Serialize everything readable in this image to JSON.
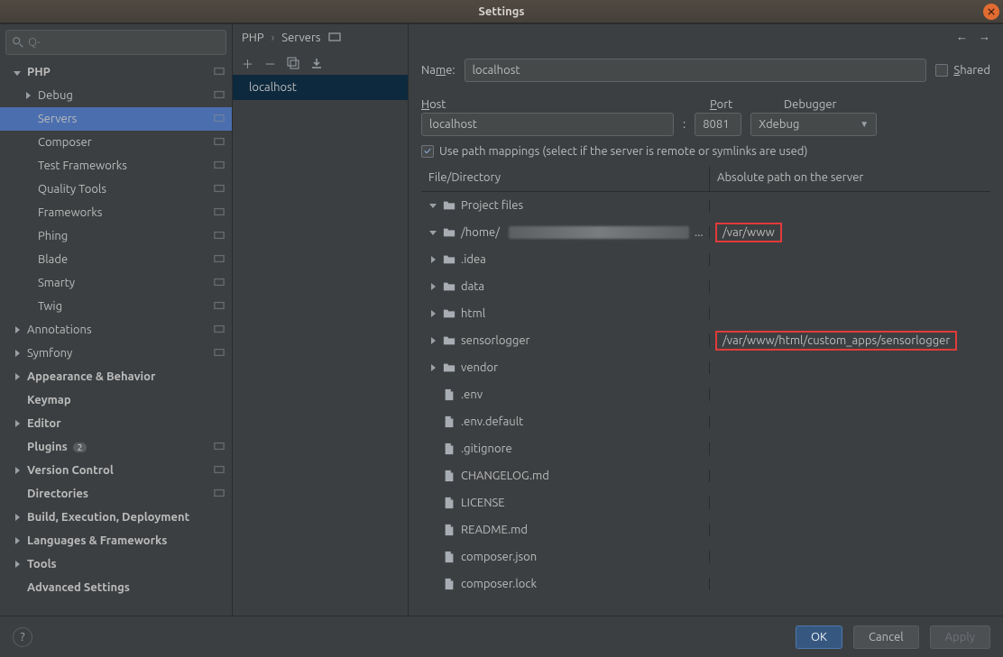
{
  "title": "Settings",
  "search_placeholder": "Q-",
  "nav_tree": [
    {
      "label": "PHP",
      "chev": "exp",
      "bold": true,
      "pin": true
    },
    {
      "label": "Debug",
      "lvl": 1,
      "chev": "col",
      "pin": true
    },
    {
      "label": "Servers",
      "lvl": 1,
      "chev": "none",
      "pin": true,
      "selected": true
    },
    {
      "label": "Composer",
      "lvl": 1,
      "chev": "none",
      "pin": true
    },
    {
      "label": "Test Frameworks",
      "lvl": 1,
      "chev": "none",
      "pin": true
    },
    {
      "label": "Quality Tools",
      "lvl": 1,
      "chev": "none",
      "pin": true
    },
    {
      "label": "Frameworks",
      "lvl": 1,
      "chev": "none",
      "pin": true
    },
    {
      "label": "Phing",
      "lvl": 1,
      "chev": "none",
      "pin": true
    },
    {
      "label": "Blade",
      "lvl": 1,
      "chev": "none",
      "pin": true
    },
    {
      "label": "Smarty",
      "lvl": 1,
      "chev": "none",
      "pin": true
    },
    {
      "label": "Twig",
      "lvl": 1,
      "chev": "none",
      "pin": true
    },
    {
      "label": "Annotations",
      "lvl": 0,
      "chev": "col",
      "pin": true
    },
    {
      "label": "Symfony",
      "lvl": 0,
      "chev": "col",
      "pin": true
    },
    {
      "label": "Appearance & Behavior",
      "chev": "col",
      "bold": true
    },
    {
      "label": "Keymap",
      "chev": "none",
      "bold": true
    },
    {
      "label": "Editor",
      "chev": "col",
      "bold": true
    },
    {
      "label": "Plugins",
      "chev": "none",
      "bold": true,
      "badge": "2",
      "pin": true
    },
    {
      "label": "Version Control",
      "chev": "col",
      "bold": true,
      "pin": true
    },
    {
      "label": "Directories",
      "chev": "none",
      "bold": true,
      "pin": true
    },
    {
      "label": "Build, Execution, Deployment",
      "chev": "col",
      "bold": true
    },
    {
      "label": "Languages & Frameworks",
      "chev": "col",
      "bold": true
    },
    {
      "label": "Tools",
      "chev": "col",
      "bold": true
    },
    {
      "label": "Advanced Settings",
      "chev": "none",
      "bold": true
    }
  ],
  "breadcrumb": {
    "a": "PHP",
    "b": "Servers"
  },
  "server_list_item": "localhost",
  "form": {
    "name_label": "Name:",
    "name_value": "localhost",
    "shared_label": "Shared",
    "host_label": "Host",
    "port_label": "Port",
    "debugger_label": "Debugger",
    "host_value": "localhost",
    "colon": ":",
    "port_value": "8081",
    "debugger_value": "Xdebug",
    "use_mappings": "Use path mappings (select if the server is remote or symlinks are used)"
  },
  "map_head": {
    "a": "File/Directory",
    "b": "Absolute path on the server"
  },
  "map_rows": [
    {
      "chev": "exp",
      "icon": "folder",
      "name": "Project files",
      "pad": 0
    },
    {
      "chev": "exp",
      "icon": "folder",
      "name": "/home/",
      "smear": true,
      "ellipsis": "...",
      "remote": "/var/www",
      "redbox": true,
      "pad": 1
    },
    {
      "chev": "col",
      "icon": "folder",
      "name": ".idea",
      "pad": 2
    },
    {
      "chev": "col",
      "icon": "folder",
      "name": "data",
      "pad": 2
    },
    {
      "chev": "col",
      "icon": "folder",
      "name": "html",
      "pad": 2
    },
    {
      "chev": "col",
      "icon": "folder",
      "name": "sensorlogger",
      "remote": "/var/www/html/custom_apps/sensorlogger",
      "redbox": true,
      "pad": 2
    },
    {
      "chev": "col",
      "icon": "folder",
      "name": "vendor",
      "pad": 2
    },
    {
      "chev": "none",
      "icon": "file",
      "name": ".env",
      "pad": 3
    },
    {
      "chev": "none",
      "icon": "file",
      "name": ".env.default",
      "pad": 3
    },
    {
      "chev": "none",
      "icon": "file",
      "name": ".gitignore",
      "pad": 3
    },
    {
      "chev": "none",
      "icon": "file",
      "name": "CHANGELOG.md",
      "pad": 3
    },
    {
      "chev": "none",
      "icon": "file",
      "name": "LICENSE",
      "pad": 3
    },
    {
      "chev": "none",
      "icon": "file",
      "name": "README.md",
      "pad": 3
    },
    {
      "chev": "none",
      "icon": "file",
      "name": "composer.json",
      "pad": 3
    },
    {
      "chev": "none",
      "icon": "file",
      "name": "composer.lock",
      "pad": 3
    }
  ],
  "buttons": {
    "ok": "OK",
    "cancel": "Cancel",
    "apply": "Apply",
    "help": "?"
  }
}
